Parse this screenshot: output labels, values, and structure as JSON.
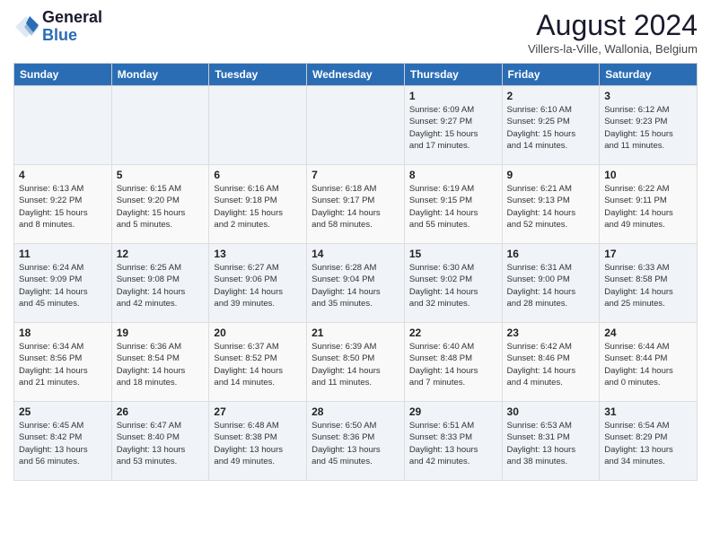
{
  "header": {
    "logo_general": "General",
    "logo_blue": "Blue",
    "month_title": "August 2024",
    "location": "Villers-la-Ville, Wallonia, Belgium"
  },
  "weekdays": [
    "Sunday",
    "Monday",
    "Tuesday",
    "Wednesday",
    "Thursday",
    "Friday",
    "Saturday"
  ],
  "weeks": [
    [
      {
        "day": "",
        "info": ""
      },
      {
        "day": "",
        "info": ""
      },
      {
        "day": "",
        "info": ""
      },
      {
        "day": "",
        "info": ""
      },
      {
        "day": "1",
        "info": "Sunrise: 6:09 AM\nSunset: 9:27 PM\nDaylight: 15 hours\nand 17 minutes."
      },
      {
        "day": "2",
        "info": "Sunrise: 6:10 AM\nSunset: 9:25 PM\nDaylight: 15 hours\nand 14 minutes."
      },
      {
        "day": "3",
        "info": "Sunrise: 6:12 AM\nSunset: 9:23 PM\nDaylight: 15 hours\nand 11 minutes."
      }
    ],
    [
      {
        "day": "4",
        "info": "Sunrise: 6:13 AM\nSunset: 9:22 PM\nDaylight: 15 hours\nand 8 minutes."
      },
      {
        "day": "5",
        "info": "Sunrise: 6:15 AM\nSunset: 9:20 PM\nDaylight: 15 hours\nand 5 minutes."
      },
      {
        "day": "6",
        "info": "Sunrise: 6:16 AM\nSunset: 9:18 PM\nDaylight: 15 hours\nand 2 minutes."
      },
      {
        "day": "7",
        "info": "Sunrise: 6:18 AM\nSunset: 9:17 PM\nDaylight: 14 hours\nand 58 minutes."
      },
      {
        "day": "8",
        "info": "Sunrise: 6:19 AM\nSunset: 9:15 PM\nDaylight: 14 hours\nand 55 minutes."
      },
      {
        "day": "9",
        "info": "Sunrise: 6:21 AM\nSunset: 9:13 PM\nDaylight: 14 hours\nand 52 minutes."
      },
      {
        "day": "10",
        "info": "Sunrise: 6:22 AM\nSunset: 9:11 PM\nDaylight: 14 hours\nand 49 minutes."
      }
    ],
    [
      {
        "day": "11",
        "info": "Sunrise: 6:24 AM\nSunset: 9:09 PM\nDaylight: 14 hours\nand 45 minutes."
      },
      {
        "day": "12",
        "info": "Sunrise: 6:25 AM\nSunset: 9:08 PM\nDaylight: 14 hours\nand 42 minutes."
      },
      {
        "day": "13",
        "info": "Sunrise: 6:27 AM\nSunset: 9:06 PM\nDaylight: 14 hours\nand 39 minutes."
      },
      {
        "day": "14",
        "info": "Sunrise: 6:28 AM\nSunset: 9:04 PM\nDaylight: 14 hours\nand 35 minutes."
      },
      {
        "day": "15",
        "info": "Sunrise: 6:30 AM\nSunset: 9:02 PM\nDaylight: 14 hours\nand 32 minutes."
      },
      {
        "day": "16",
        "info": "Sunrise: 6:31 AM\nSunset: 9:00 PM\nDaylight: 14 hours\nand 28 minutes."
      },
      {
        "day": "17",
        "info": "Sunrise: 6:33 AM\nSunset: 8:58 PM\nDaylight: 14 hours\nand 25 minutes."
      }
    ],
    [
      {
        "day": "18",
        "info": "Sunrise: 6:34 AM\nSunset: 8:56 PM\nDaylight: 14 hours\nand 21 minutes."
      },
      {
        "day": "19",
        "info": "Sunrise: 6:36 AM\nSunset: 8:54 PM\nDaylight: 14 hours\nand 18 minutes."
      },
      {
        "day": "20",
        "info": "Sunrise: 6:37 AM\nSunset: 8:52 PM\nDaylight: 14 hours\nand 14 minutes."
      },
      {
        "day": "21",
        "info": "Sunrise: 6:39 AM\nSunset: 8:50 PM\nDaylight: 14 hours\nand 11 minutes."
      },
      {
        "day": "22",
        "info": "Sunrise: 6:40 AM\nSunset: 8:48 PM\nDaylight: 14 hours\nand 7 minutes."
      },
      {
        "day": "23",
        "info": "Sunrise: 6:42 AM\nSunset: 8:46 PM\nDaylight: 14 hours\nand 4 minutes."
      },
      {
        "day": "24",
        "info": "Sunrise: 6:44 AM\nSunset: 8:44 PM\nDaylight: 14 hours\nand 0 minutes."
      }
    ],
    [
      {
        "day": "25",
        "info": "Sunrise: 6:45 AM\nSunset: 8:42 PM\nDaylight: 13 hours\nand 56 minutes."
      },
      {
        "day": "26",
        "info": "Sunrise: 6:47 AM\nSunset: 8:40 PM\nDaylight: 13 hours\nand 53 minutes."
      },
      {
        "day": "27",
        "info": "Sunrise: 6:48 AM\nSunset: 8:38 PM\nDaylight: 13 hours\nand 49 minutes."
      },
      {
        "day": "28",
        "info": "Sunrise: 6:50 AM\nSunset: 8:36 PM\nDaylight: 13 hours\nand 45 minutes."
      },
      {
        "day": "29",
        "info": "Sunrise: 6:51 AM\nSunset: 8:33 PM\nDaylight: 13 hours\nand 42 minutes."
      },
      {
        "day": "30",
        "info": "Sunrise: 6:53 AM\nSunset: 8:31 PM\nDaylight: 13 hours\nand 38 minutes."
      },
      {
        "day": "31",
        "info": "Sunrise: 6:54 AM\nSunset: 8:29 PM\nDaylight: 13 hours\nand 34 minutes."
      }
    ]
  ]
}
